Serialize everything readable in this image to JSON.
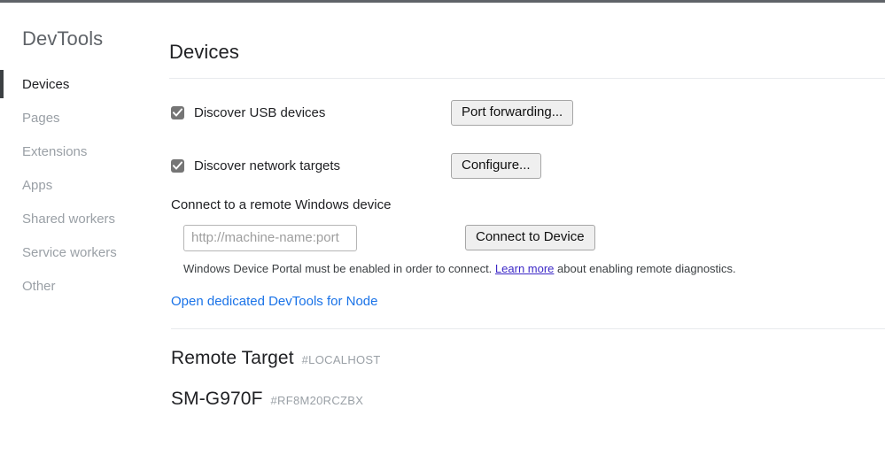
{
  "window": {
    "top_border_color": "#5f6368"
  },
  "sidebar": {
    "title": "DevTools",
    "items": [
      {
        "label": "Devices",
        "selected": true
      },
      {
        "label": "Pages",
        "selected": false
      },
      {
        "label": "Extensions",
        "selected": false
      },
      {
        "label": "Apps",
        "selected": false
      },
      {
        "label": "Shared workers",
        "selected": false
      },
      {
        "label": "Service workers",
        "selected": false
      },
      {
        "label": "Other",
        "selected": false
      }
    ]
  },
  "main": {
    "title": "Devices",
    "discover_usb": {
      "label": "Discover USB devices",
      "checked": true,
      "button_label": "Port forwarding..."
    },
    "discover_network": {
      "label": "Discover network targets",
      "checked": true,
      "button_label": "Configure..."
    },
    "connect_remote": {
      "heading": "Connect to a remote Windows device",
      "input_value": "",
      "input_placeholder": "http://machine-name:port",
      "button_label": "Connect to Device",
      "help_text_before": "Windows Device Portal must be enabled in order to connect.",
      "help_link_text": "Learn more",
      "help_text_after": "about enabling remote diagnostics."
    },
    "node_link_label": "Open dedicated DevTools for Node",
    "targets": [
      {
        "name": "Remote Target",
        "id": "#LOCALHOST"
      },
      {
        "name": "SM-G970F",
        "id": "#RF8M20RCZBX"
      }
    ]
  },
  "colors": {
    "accent_link": "#1a73e8",
    "inline_link": "#3c28c7",
    "checkbox_fill": "#757575",
    "divider": "#e8eaed",
    "muted_text": "#9aa0a6"
  }
}
